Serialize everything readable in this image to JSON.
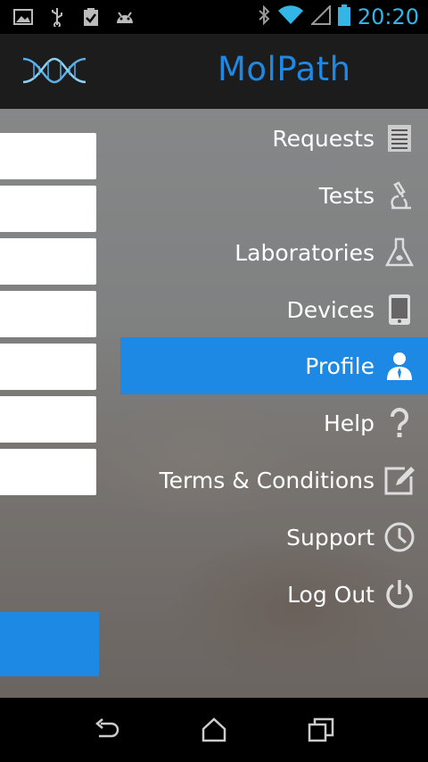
{
  "status_bar": {
    "time": "20:20",
    "icons": [
      "image-icon",
      "usb-icon",
      "clipboard-check-icon",
      "android-icon",
      "bluetooth-icon",
      "wifi-icon",
      "signal-icon",
      "battery-icon"
    ]
  },
  "header": {
    "title": "MolPath",
    "logo": "dna-logo"
  },
  "menu": {
    "items": [
      {
        "label": "Requests",
        "icon": "list-icon"
      },
      {
        "label": "Tests",
        "icon": "microscope-icon"
      },
      {
        "label": "Laboratories",
        "icon": "flask-icon"
      },
      {
        "label": "Devices",
        "icon": "tablet-icon"
      },
      {
        "label": "Profile",
        "icon": "user-icon",
        "selected": true
      },
      {
        "label": "Help",
        "icon": "question-icon"
      },
      {
        "label": "Terms & Conditions",
        "icon": "edit-icon"
      },
      {
        "label": "Support",
        "icon": "clock-icon"
      },
      {
        "label": "Log Out",
        "icon": "power-icon"
      }
    ]
  },
  "nav_bar": {
    "buttons": [
      "back-icon",
      "home-icon",
      "recents-icon"
    ]
  },
  "colors": {
    "accent": "#1e88e5",
    "status_blue": "#33b5e5",
    "header_bg": "#1c1c1c"
  }
}
